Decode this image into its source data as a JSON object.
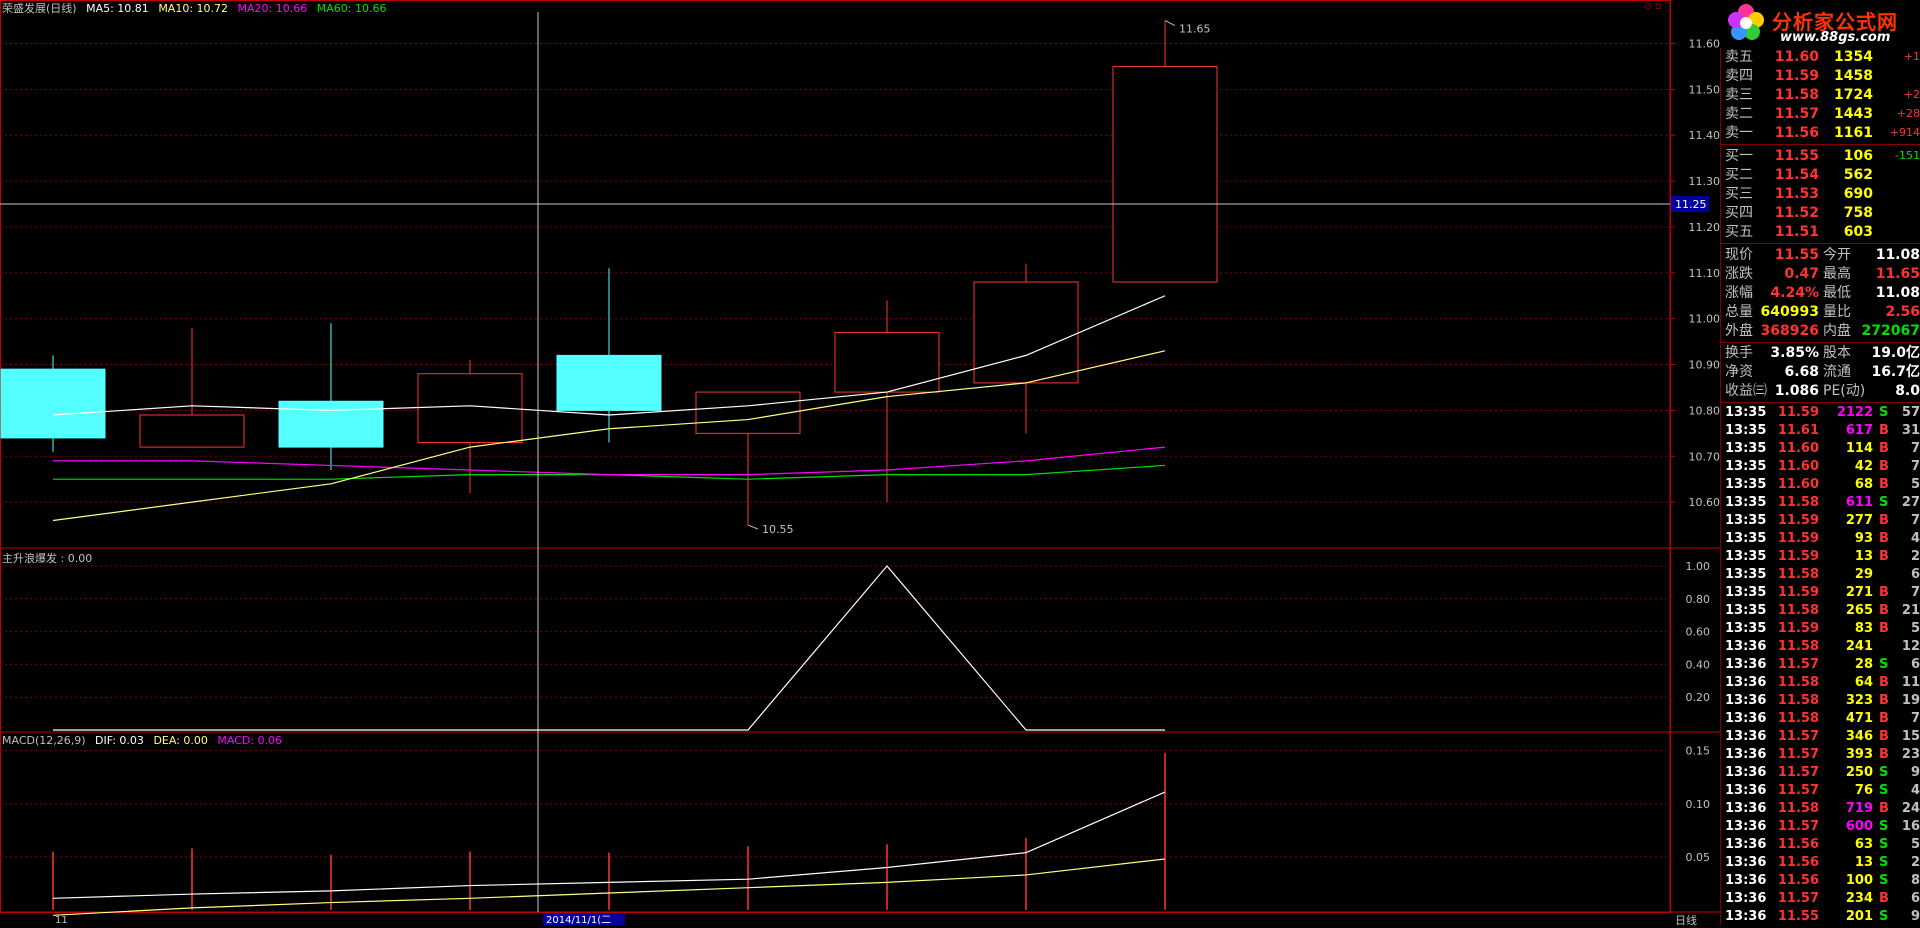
{
  "header": {
    "title": "荣盛发展(日线)",
    "ma5": "MA5: 10.81",
    "ma10": "MA10: 10.72",
    "ma20": "MA20: 10.66",
    "ma60": "MA60: 10.66"
  },
  "colors": {
    "up": "#ff3232",
    "down": "#54ffff",
    "ma5": "#ffffff",
    "ma10": "#ffff80",
    "ma20": "#ff00ff",
    "ma60": "#00e000",
    "grid": "#800000",
    "axis": "#c00000"
  },
  "main_chart": {
    "y_ticks": [
      "11.60",
      "11.50",
      "11.40",
      "11.30",
      "11.20",
      "11.10",
      "11.00",
      "10.90",
      "10.80",
      "10.70",
      "10.60"
    ],
    "crosshair_value": "11.25",
    "high_marker": "11.65",
    "low_marker": "10.55"
  },
  "indicator1": {
    "label": "主升浪爆发 : 0.00",
    "y_ticks": [
      "1.00",
      "0.80",
      "0.60",
      "0.40",
      "0.20"
    ]
  },
  "macd": {
    "label_name": "MACD(12,26,9)",
    "dif": "DIF: 0.03",
    "dea": "DEA: 0.00",
    "macd": "MACD: 0.06",
    "y_ticks": [
      "0.15",
      "0.10",
      "0.05"
    ]
  },
  "x_axis": {
    "left_label": "11",
    "date_label": "2014/11/1(二",
    "bottom_tab": "日线"
  },
  "chart_data": {
    "type": "candlestick",
    "candles": [
      {
        "open": 10.74,
        "close": 10.89,
        "high": 10.92,
        "low": 10.71,
        "kind": "down"
      },
      {
        "open": 10.72,
        "close": 10.79,
        "high": 10.98,
        "low": 10.72,
        "kind": "up"
      },
      {
        "open": 10.72,
        "close": 10.82,
        "high": 10.99,
        "low": 10.67,
        "kind": "down"
      },
      {
        "open": 10.73,
        "close": 10.88,
        "high": 10.91,
        "low": 10.62,
        "kind": "up"
      },
      {
        "open": 10.8,
        "close": 10.92,
        "high": 11.11,
        "low": 10.73,
        "kind": "down"
      },
      {
        "open": 10.75,
        "close": 10.84,
        "high": 10.84,
        "low": 10.55,
        "kind": "up"
      },
      {
        "open": 10.84,
        "close": 10.97,
        "high": 11.04,
        "low": 10.6,
        "kind": "up"
      },
      {
        "open": 10.86,
        "close": 11.08,
        "high": 11.12,
        "low": 10.75,
        "kind": "up"
      },
      {
        "open": 11.08,
        "close": 11.55,
        "high": 11.65,
        "low": 11.08,
        "kind": "up"
      }
    ],
    "ma5": [
      10.79,
      10.81,
      10.8,
      10.81,
      10.79,
      10.81,
      10.84,
      10.92,
      11.05
    ],
    "ma10": [
      10.56,
      10.6,
      10.64,
      10.72,
      10.76,
      10.78,
      10.83,
      10.86,
      10.93
    ],
    "ma20": [
      10.69,
      10.69,
      10.68,
      10.67,
      10.66,
      10.66,
      10.67,
      10.69,
      10.72
    ],
    "ma60": [
      10.65,
      10.65,
      10.65,
      10.66,
      10.66,
      10.65,
      10.66,
      10.66,
      10.68
    ],
    "indicator": [
      0,
      0,
      0,
      0,
      0,
      0,
      1.0,
      0,
      0
    ],
    "macd_dif": [
      0.011,
      0.015,
      0.018,
      0.023,
      0.026,
      0.029,
      0.04,
      0.054,
      0.111
    ],
    "macd_dea": [
      -0.005,
      0.002,
      0.007,
      0.011,
      0.016,
      0.021,
      0.026,
      0.033,
      0.048
    ],
    "macd_bar": [
      0.055,
      0.058,
      0.052,
      0.055,
      0.054,
      0.06,
      0.062,
      0.068,
      0.148
    ],
    "y_range": [
      10.5,
      11.66
    ]
  },
  "order_book": {
    "asks": [
      {
        "label": "卖五",
        "price": "11.60",
        "vol": "1354",
        "chg": "+1"
      },
      {
        "label": "卖四",
        "price": "11.59",
        "vol": "1458",
        "chg": ""
      },
      {
        "label": "卖三",
        "price": "11.58",
        "vol": "1724",
        "chg": "+2"
      },
      {
        "label": "卖二",
        "price": "11.57",
        "vol": "1443",
        "chg": "+28"
      },
      {
        "label": "卖一",
        "price": "11.56",
        "vol": "1161",
        "chg": "+914"
      }
    ],
    "bids": [
      {
        "label": "买一",
        "price": "11.55",
        "vol": "106",
        "chg": "-151"
      },
      {
        "label": "买二",
        "price": "11.54",
        "vol": "562",
        "chg": ""
      },
      {
        "label": "买三",
        "price": "11.53",
        "vol": "690",
        "chg": ""
      },
      {
        "label": "买四",
        "price": "11.52",
        "vol": "758",
        "chg": ""
      },
      {
        "label": "买五",
        "price": "11.51",
        "vol": "603",
        "chg": ""
      }
    ]
  },
  "quote": [
    {
      "l1": "现价",
      "v1": "11.55",
      "l2": "今开",
      "v2": "11.08",
      "c1": "#ff3232",
      "c2": "#ffffff"
    },
    {
      "l1": "涨跌",
      "v1": "0.47",
      "l2": "最高",
      "v2": "11.65",
      "c1": "#ff3232",
      "c2": "#ff3232"
    },
    {
      "l1": "涨幅",
      "v1": "4.24%",
      "l2": "最低",
      "v2": "11.08",
      "c1": "#ff3232",
      "c2": "#ffffff"
    },
    {
      "l1": "总量",
      "v1": "640993",
      "l2": "量比",
      "v2": "2.56",
      "c1": "#ffff00",
      "c2": "#ff3232"
    },
    {
      "l1": "外盘",
      "v1": "368926",
      "l2": "内盘",
      "v2": "272067",
      "c1": "#ff3232",
      "c2": "#00e000"
    },
    {
      "l1": "换手",
      "v1": "3.85%",
      "l2": "股本",
      "v2": "19.0亿",
      "c1": "#ffffff",
      "c2": "#ffffff"
    },
    {
      "l1": "净资",
      "v1": "6.68",
      "l2": "流通",
      "v2": "16.7亿",
      "c1": "#ffffff",
      "c2": "#ffffff"
    },
    {
      "l1": "收益㈢",
      "v1": "1.086",
      "l2": "PE(动)",
      "v2": "8.0",
      "c1": "#ffffff",
      "c2": "#ffffff"
    }
  ],
  "ticks": [
    {
      "t": "13:35",
      "p": "11.59",
      "v": "2122",
      "s": "S",
      "n": "57",
      "pc": "#ff3232",
      "vc": "#ff00ff"
    },
    {
      "t": "13:35",
      "p": "11.61",
      "v": "617",
      "s": "B",
      "n": "31",
      "pc": "#ff3232",
      "vc": "#ff00ff"
    },
    {
      "t": "13:35",
      "p": "11.60",
      "v": "114",
      "s": "B",
      "n": "7",
      "pc": "#ff3232",
      "vc": "#ffff00"
    },
    {
      "t": "13:35",
      "p": "11.60",
      "v": "42",
      "s": "B",
      "n": "7",
      "pc": "#ff3232",
      "vc": "#ffff00"
    },
    {
      "t": "13:35",
      "p": "11.60",
      "v": "68",
      "s": "B",
      "n": "5",
      "pc": "#ff3232",
      "vc": "#ffff00"
    },
    {
      "t": "13:35",
      "p": "11.58",
      "v": "611",
      "s": "S",
      "n": "27",
      "pc": "#ff3232",
      "vc": "#ff00ff"
    },
    {
      "t": "13:35",
      "p": "11.59",
      "v": "277",
      "s": "B",
      "n": "7",
      "pc": "#ff3232",
      "vc": "#ffff00"
    },
    {
      "t": "13:35",
      "p": "11.59",
      "v": "93",
      "s": "B",
      "n": "4",
      "pc": "#ff3232",
      "vc": "#ffff00"
    },
    {
      "t": "13:35",
      "p": "11.59",
      "v": "13",
      "s": "B",
      "n": "2",
      "pc": "#ff3232",
      "vc": "#ffff00"
    },
    {
      "t": "13:35",
      "p": "11.58",
      "v": "29",
      "s": "",
      "n": "6",
      "pc": "#ff3232",
      "vc": "#ffff00"
    },
    {
      "t": "13:35",
      "p": "11.59",
      "v": "271",
      "s": "B",
      "n": "7",
      "pc": "#ff3232",
      "vc": "#ffff00"
    },
    {
      "t": "13:35",
      "p": "11.58",
      "v": "265",
      "s": "B",
      "n": "21",
      "pc": "#ff3232",
      "vc": "#ffff00"
    },
    {
      "t": "13:35",
      "p": "11.59",
      "v": "83",
      "s": "B",
      "n": "5",
      "pc": "#ff3232",
      "vc": "#ffff00"
    },
    {
      "t": "13:36",
      "p": "11.58",
      "v": "241",
      "s": "",
      "n": "12",
      "pc": "#ff3232",
      "vc": "#ffff00"
    },
    {
      "t": "13:36",
      "p": "11.57",
      "v": "28",
      "s": "S",
      "n": "6",
      "pc": "#ff3232",
      "vc": "#ffff00"
    },
    {
      "t": "13:36",
      "p": "11.58",
      "v": "64",
      "s": "B",
      "n": "11",
      "pc": "#ff3232",
      "vc": "#ffff00"
    },
    {
      "t": "13:36",
      "p": "11.58",
      "v": "323",
      "s": "B",
      "n": "19",
      "pc": "#ff3232",
      "vc": "#ffff00"
    },
    {
      "t": "13:36",
      "p": "11.58",
      "v": "471",
      "s": "B",
      "n": "7",
      "pc": "#ff3232",
      "vc": "#ffff00"
    },
    {
      "t": "13:36",
      "p": "11.57",
      "v": "346",
      "s": "B",
      "n": "15",
      "pc": "#ff3232",
      "vc": "#ffff00"
    },
    {
      "t": "13:36",
      "p": "11.57",
      "v": "393",
      "s": "B",
      "n": "23",
      "pc": "#ff3232",
      "vc": "#ffff00"
    },
    {
      "t": "13:36",
      "p": "11.57",
      "v": "250",
      "s": "S",
      "n": "9",
      "pc": "#ff3232",
      "vc": "#ffff00"
    },
    {
      "t": "13:36",
      "p": "11.57",
      "v": "76",
      "s": "S",
      "n": "4",
      "pc": "#ff3232",
      "vc": "#ffff00"
    },
    {
      "t": "13:36",
      "p": "11.58",
      "v": "719",
      "s": "B",
      "n": "24",
      "pc": "#ff3232",
      "vc": "#ff00ff"
    },
    {
      "t": "13:36",
      "p": "11.57",
      "v": "600",
      "s": "S",
      "n": "16",
      "pc": "#ff3232",
      "vc": "#ff00ff"
    },
    {
      "t": "13:36",
      "p": "11.56",
      "v": "63",
      "s": "S",
      "n": "5",
      "pc": "#ff3232",
      "vc": "#ffff00"
    },
    {
      "t": "13:36",
      "p": "11.56",
      "v": "13",
      "s": "S",
      "n": "2",
      "pc": "#ff3232",
      "vc": "#ffff00"
    },
    {
      "t": "13:36",
      "p": "11.56",
      "v": "100",
      "s": "S",
      "n": "8",
      "pc": "#ff3232",
      "vc": "#ffff00"
    },
    {
      "t": "13:36",
      "p": "11.57",
      "v": "234",
      "s": "B",
      "n": "6",
      "pc": "#ff3232",
      "vc": "#ffff00"
    },
    {
      "t": "13:36",
      "p": "11.55",
      "v": "201",
      "s": "S",
      "n": "9",
      "pc": "#ff3232",
      "vc": "#ffff00"
    }
  ],
  "logo": {
    "title": "分析家公式网",
    "url": "www.88gs.com"
  }
}
